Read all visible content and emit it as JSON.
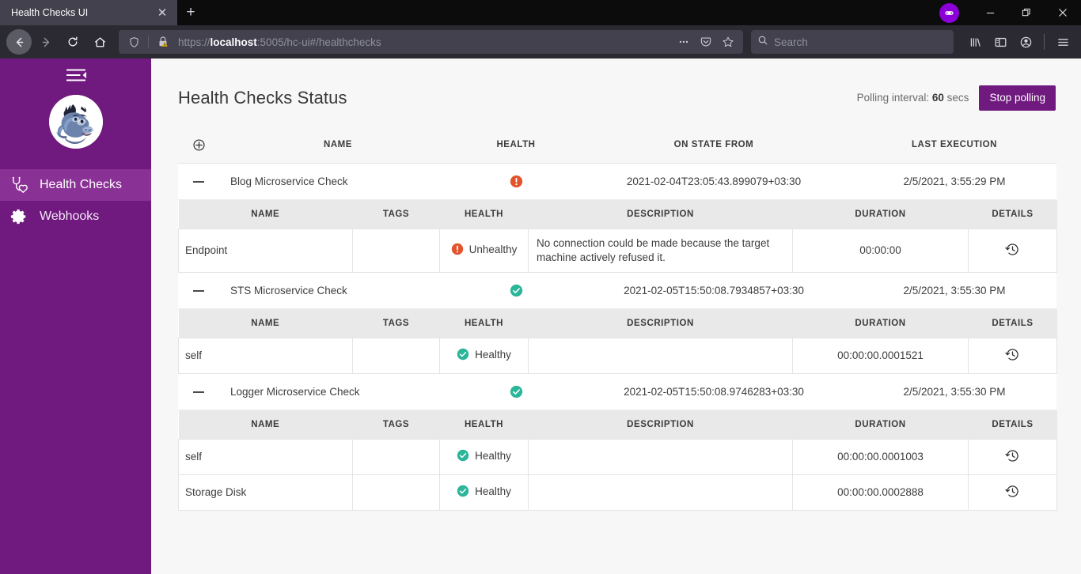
{
  "browser": {
    "tab": {
      "title": "Health Checks UI",
      "close_label": "✕"
    },
    "new_tab_label": "+",
    "nav": {
      "back_icon": "back-arrow-icon",
      "forward_icon": "forward-arrow-icon",
      "reload_icon": "reload-icon",
      "home_icon": "home-icon"
    },
    "url": {
      "scheme": "https://",
      "host": "localhost",
      "rest": ":5005/hc-ui#/healthchecks",
      "full": "https://localhost:5005/hc-ui#/healthchecks",
      "shield_icon": "tracking-protection-shield-icon",
      "lock_icon": "insecure-lock-warning-icon",
      "more_label": "•••",
      "pocket_icon": "pocket-icon",
      "bookmark_icon": "star-bookmark-icon"
    },
    "search": {
      "placeholder": "Search",
      "icon": "search-icon"
    },
    "toolbar_icons": [
      "library-icon",
      "sidebar-icon",
      "account-icon",
      "app-menu-icon"
    ],
    "extension": {
      "name": "extension-badge",
      "glyph": "∞"
    },
    "window_controls": {
      "minimize": "−",
      "restore": "❐",
      "close": "✕"
    }
  },
  "sidebar": {
    "toggle_icon": "collapse-menu-icon",
    "avatar_alt": "gorilla-mascot-avatar",
    "items": [
      {
        "label": "Health Checks",
        "icon": "stethoscope-heart-icon",
        "active": true
      },
      {
        "label": "Webhooks",
        "icon": "gear-icon",
        "active": false
      }
    ]
  },
  "header": {
    "title": "Health Checks Status",
    "polling_prefix": "Polling interval:",
    "polling_value": "60",
    "polling_suffix": "secs",
    "stop_button": "Stop polling"
  },
  "table": {
    "expand_all_icon": "circle-plus-icon",
    "columns": [
      "",
      "NAME",
      "HEALTH",
      "ON STATE FROM",
      "LAST EXECUTION"
    ],
    "sub_columns": [
      "NAME",
      "TAGS",
      "HEALTH",
      "DESCRIPTION",
      "DURATION",
      "DETAILS"
    ],
    "collapse_icon": "minus-icon",
    "details_icon": "history-clock-icon",
    "rows": [
      {
        "name": "Blog Microservice Check",
        "status": "unhealthy",
        "on_state_from": "2021-02-04T23:05:43.899079+03:30",
        "last_execution": "2/5/2021, 3:55:29 PM",
        "entries": [
          {
            "name": "Endpoint",
            "tags": "",
            "health": "Unhealthy",
            "health_status": "unhealthy",
            "description": "No connection could be made because the target machine actively refused it.",
            "duration": "00:00:00"
          }
        ]
      },
      {
        "name": "STS Microservice Check",
        "status": "healthy",
        "on_state_from": "2021-02-05T15:50:08.7934857+03:30",
        "last_execution": "2/5/2021, 3:55:30 PM",
        "entries": [
          {
            "name": "self",
            "tags": "",
            "health": "Healthy",
            "health_status": "healthy",
            "description": "",
            "duration": "00:00:00.0001521"
          }
        ]
      },
      {
        "name": "Logger Microservice Check",
        "status": "healthy",
        "on_state_from": "2021-02-05T15:50:08.9746283+03:30",
        "last_execution": "2/5/2021, 3:55:30 PM",
        "entries": [
          {
            "name": "self",
            "tags": "",
            "health": "Healthy",
            "health_status": "healthy",
            "description": "",
            "duration": "00:00:00.0001003"
          },
          {
            "name": "Storage Disk",
            "tags": "",
            "health": "Healthy",
            "health_status": "healthy",
            "description": "",
            "duration": "00:00:00.0002888"
          }
        ]
      }
    ]
  },
  "colors": {
    "brand_purple": "#70197e",
    "brand_purple_active": "#8a3196",
    "healthy_green": "#2bb599",
    "unhealthy_orange": "#e2542c",
    "page_bg": "#f7f7f7",
    "chrome_dark": "#2b2a33"
  }
}
